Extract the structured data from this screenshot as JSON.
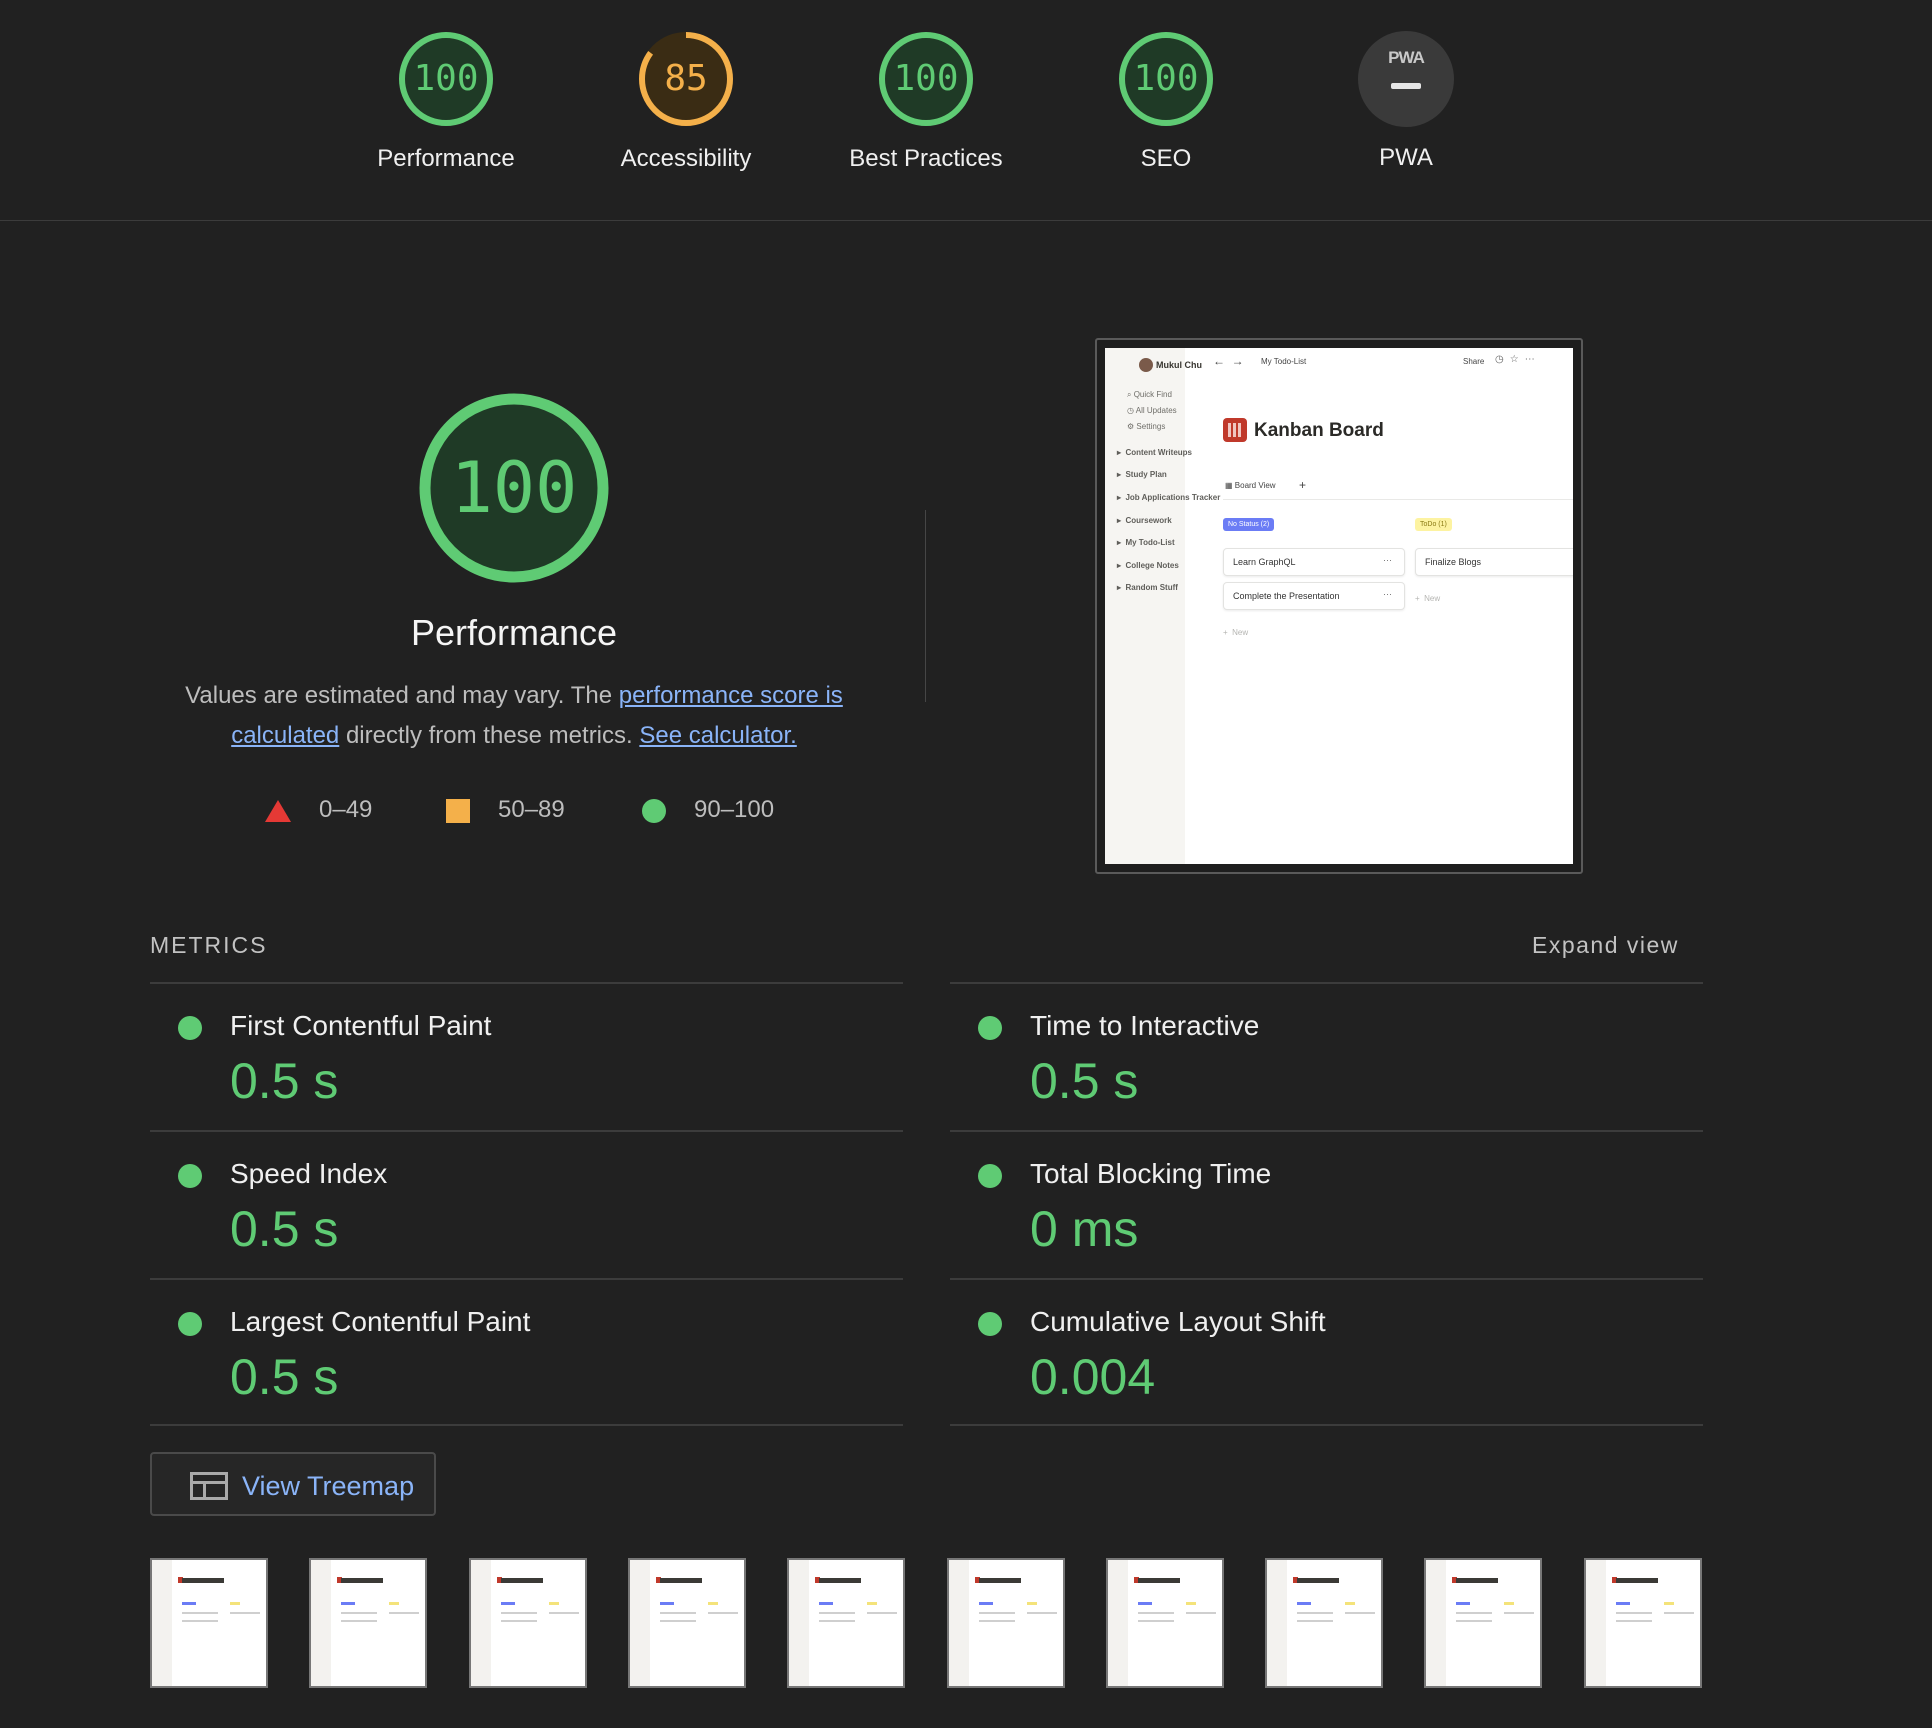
{
  "categories": [
    {
      "label": "Performance",
      "score": "100",
      "value": 100,
      "color": "#5fcb74"
    },
    {
      "label": "Accessibility",
      "score": "85",
      "value": 85,
      "color": "#f4b04a"
    },
    {
      "label": "Best Practices",
      "score": "100",
      "value": 100,
      "color": "#5fcb74"
    },
    {
      "label": "SEO",
      "score": "100",
      "value": 100,
      "color": "#5fcb74"
    },
    {
      "label": "PWA",
      "badge": "PWA",
      "color": "#3a3a3a"
    }
  ],
  "main": {
    "score": "100",
    "score_value": 100,
    "title": "Performance",
    "desc_before": "Values are estimated and may vary. The ",
    "desc_link1": "performance score is calculated",
    "desc_middle": " directly from these metrics. ",
    "desc_link2": "See calculator."
  },
  "legend": [
    {
      "range": "0–49",
      "color": "#e53935"
    },
    {
      "range": "50–89",
      "color": "#f4b04a"
    },
    {
      "range": "90–100",
      "color": "#5fcb74"
    }
  ],
  "screenshot": {
    "user": "Mukul Chu",
    "breadcrumb": "My Todo-List",
    "share": "Share",
    "sidebar_items": [
      "Quick Find",
      "All Updates",
      "Settings"
    ],
    "tree_items": [
      "Content Writeups",
      "Study Plan",
      "Job Applications Tracker",
      "Coursework",
      "My Todo-List",
      "College Notes",
      "Random Stuff"
    ],
    "page_title": "Kanban Board",
    "view_tab": "Board View",
    "col1_tag": "No Status (2)",
    "col2_tag": "ToDo (1)",
    "cards": [
      "Learn GraphQL",
      "Complete the Presentation",
      "Finalize Blogs"
    ],
    "new_label": "New"
  },
  "metrics": {
    "title": "METRICS",
    "expand": "Expand view",
    "items": [
      {
        "name": "First Contentful Paint",
        "value": "0.5 s"
      },
      {
        "name": "Time to Interactive",
        "value": "0.5 s"
      },
      {
        "name": "Speed Index",
        "value": "0.5 s"
      },
      {
        "name": "Total Blocking Time",
        "value": "0 ms"
      },
      {
        "name": "Largest Contentful Paint",
        "value": "0.5 s"
      },
      {
        "name": "Cumulative Layout Shift",
        "value": "0.004"
      }
    ]
  },
  "treemap": {
    "label": "View Treemap"
  },
  "filmstrip": {
    "count": 10
  }
}
